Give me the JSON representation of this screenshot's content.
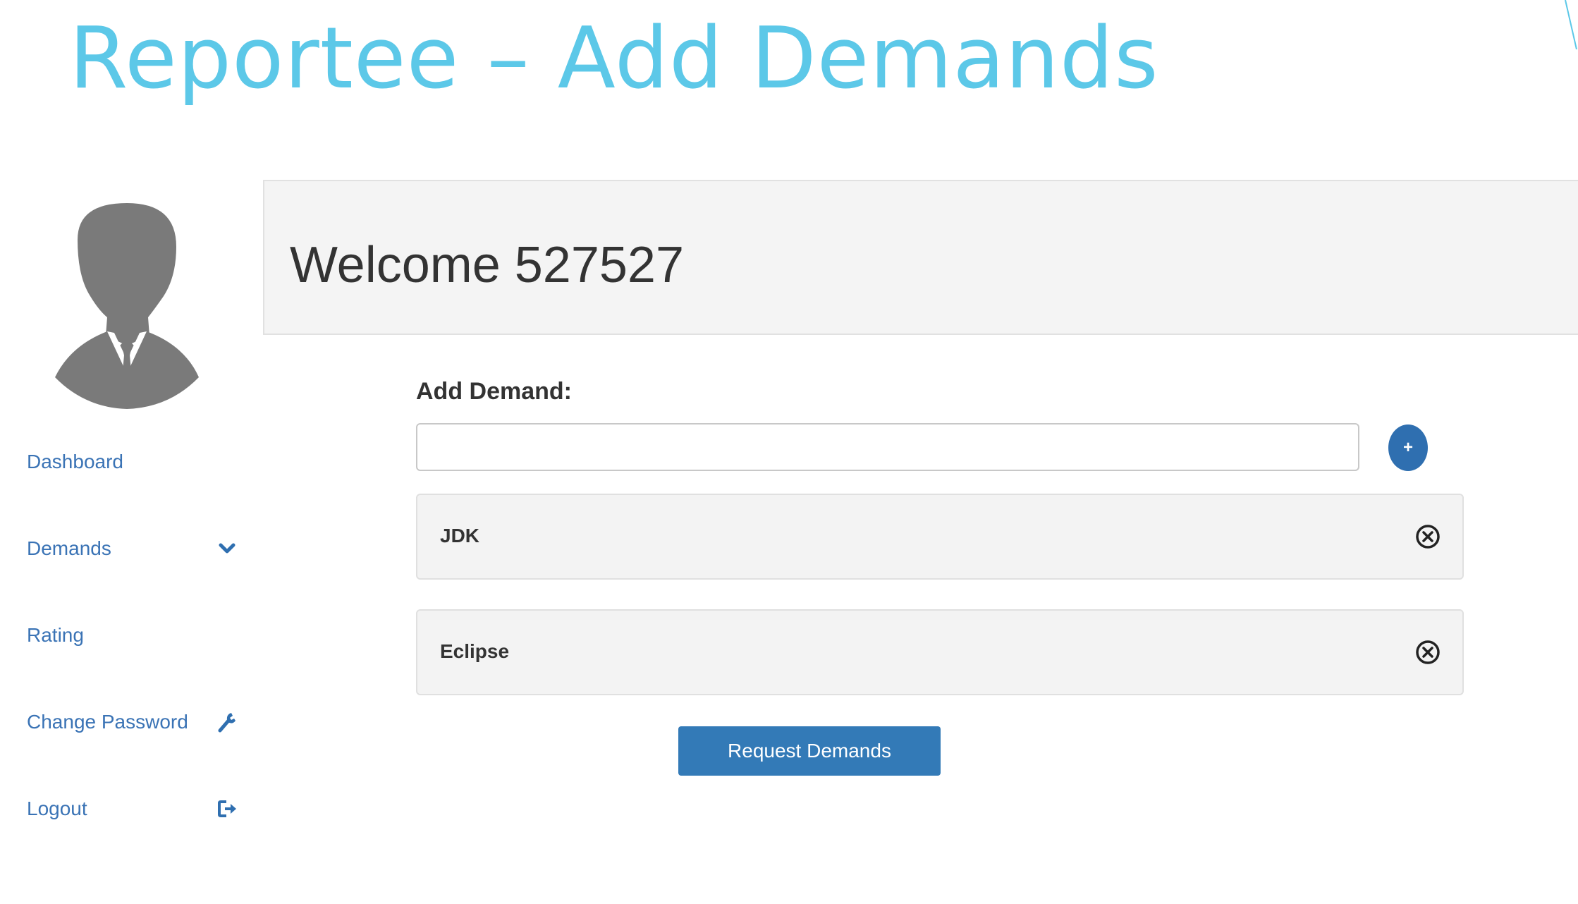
{
  "slide": {
    "title": "Reportee – Add Demands"
  },
  "sidebar": {
    "items": [
      {
        "label": "Dashboard",
        "icon": ""
      },
      {
        "label": "Demands",
        "icon": "chevron-down-icon"
      },
      {
        "label": "Rating",
        "icon": ""
      },
      {
        "label": "Change Password",
        "icon": "wrench-icon"
      },
      {
        "label": "Logout",
        "icon": "logout-icon"
      }
    ]
  },
  "header": {
    "welcome": "Welcome 527527"
  },
  "form": {
    "label": "Add Demand:",
    "input_value": "",
    "input_placeholder": "",
    "add_button_label": "+"
  },
  "demands": [
    {
      "label": "JDK"
    },
    {
      "label": "Eclipse"
    }
  ],
  "actions": {
    "request_label": "Request Demands"
  },
  "colors": {
    "title": "#5cc8e8",
    "nav_link": "#3a73b5",
    "primary_button": "#337ab7",
    "add_button": "#2f6fb0",
    "panel_bg": "#f4f4f4"
  }
}
